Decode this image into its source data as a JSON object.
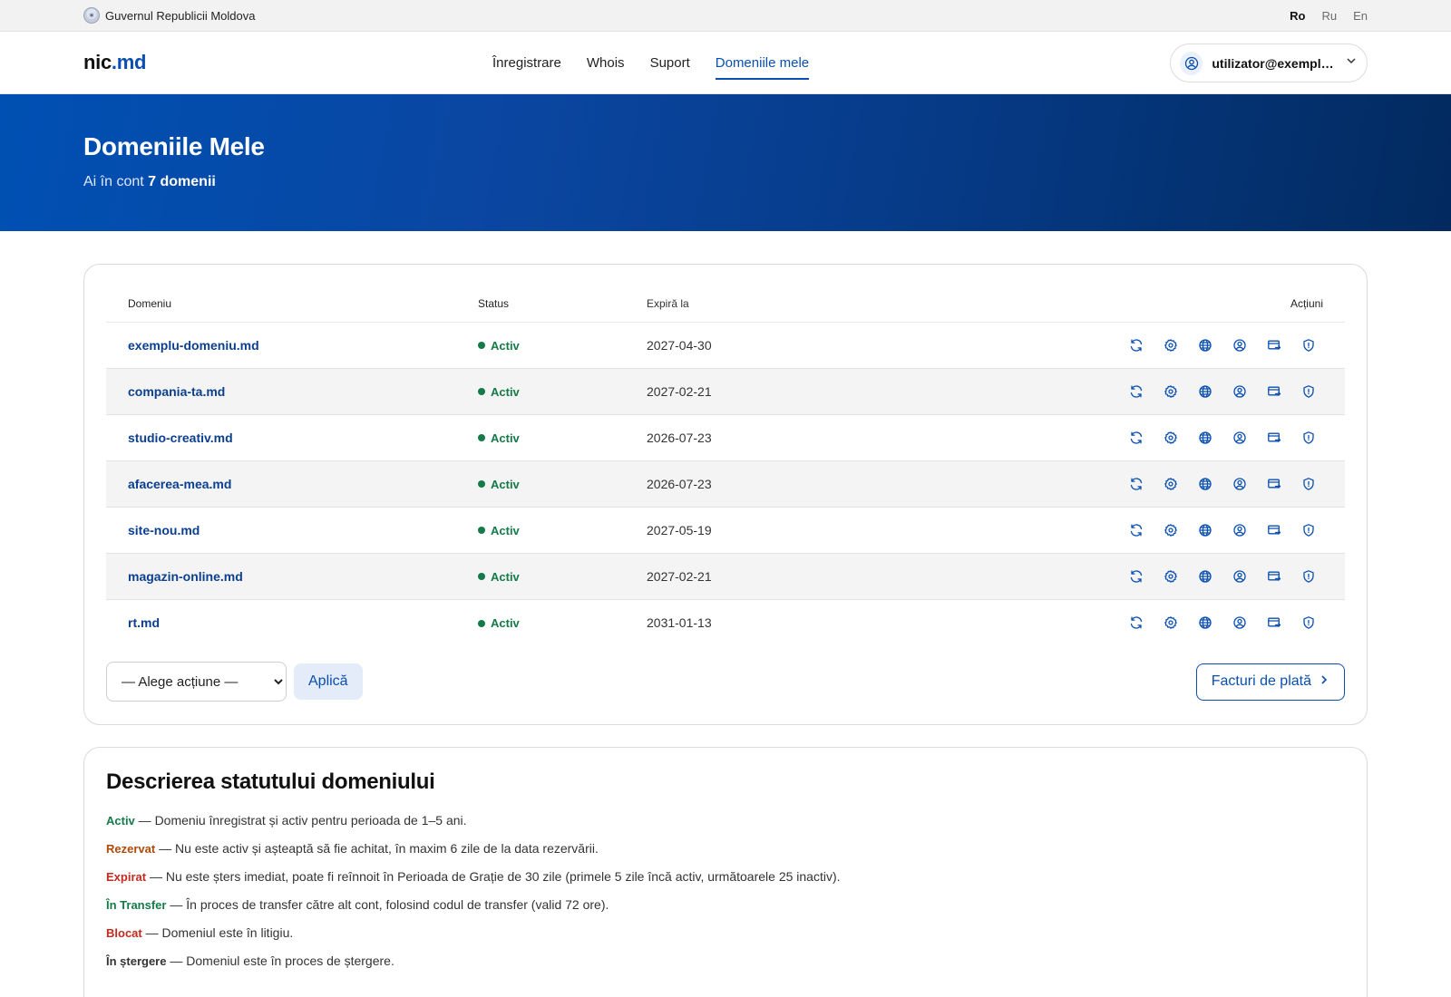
{
  "govbar": {
    "title": "Guvernul Republicii Moldova",
    "languages": [
      "Ro",
      "Ru",
      "En"
    ],
    "active_language": "Ro"
  },
  "header": {
    "logo_main": "nic",
    "logo_suffix": ".md",
    "nav": [
      {
        "label": "Înregistrare"
      },
      {
        "label": "Whois"
      },
      {
        "label": "Suport"
      },
      {
        "label": "Domeniile mele"
      }
    ],
    "active_nav": "Domeniile mele",
    "user_email": "utilizator@exemplu..."
  },
  "hero": {
    "title": "Domeniile Mele",
    "subtitle_prefix": "Ai în cont",
    "subtitle_count": "7 domenii"
  },
  "table": {
    "columns": {
      "domain": "Domeniu",
      "status": "Status",
      "expires": "Expiră la",
      "actions": "Acțiuni"
    },
    "rows": [
      {
        "domain": "exemplu-domeniu.md",
        "status": "Activ",
        "expires": "2027-04-30"
      },
      {
        "domain": "compania-ta.md",
        "status": "Activ",
        "expires": "2027-02-21"
      },
      {
        "domain": "studio-creativ.md",
        "status": "Activ",
        "expires": "2026-07-23"
      },
      {
        "domain": "afacerea-mea.md",
        "status": "Activ",
        "expires": "2026-07-23"
      },
      {
        "domain": "site-nou.md",
        "status": "Activ",
        "expires": "2027-05-19"
      },
      {
        "domain": "magazin-online.md",
        "status": "Activ",
        "expires": "2027-02-21"
      },
      {
        "domain": "rt.md",
        "status": "Activ",
        "expires": "2031-01-13"
      }
    ],
    "row_action_icons": [
      "renew-icon",
      "settings-icon",
      "dns-globe-icon",
      "contact-icon",
      "transfer-icon",
      "security-shield-icon"
    ]
  },
  "footer_actions": {
    "bulk_select_value": "— Alege acțiune —",
    "apply_label": "Aplică",
    "invoices_label": "Facturi de plată"
  },
  "status_description": {
    "title": "Descrierea statutului domeniului",
    "items": [
      {
        "key": "Activ",
        "text": " — Domeniu înregistrat și activ pentru perioada de 1–5 ani.",
        "color": "#147a48"
      },
      {
        "key": "Rezervat",
        "text": " — Nu este activ și așteaptă să fie achitat, în maxim 6 zile de la data rezervării.",
        "color": "#b04a0a"
      },
      {
        "key": "Expirat",
        "text": " — Nu este șters imediat, poate fi reînnoit în Perioada de Grație de 30 zile (primele 5 zile încă activ, următoarele 25 inactiv).",
        "color": "#c22a1f"
      },
      {
        "key": "În Transfer",
        "text": " — În proces de transfer către alt cont, folosind codul de transfer (valid 72 ore).",
        "color": "#147a48"
      },
      {
        "key": "Blocat",
        "text": " — Domeniul este în litigiu.",
        "color": "#c22a1f"
      },
      {
        "key": "În ștergere",
        "text": " — Domeniul este în proces de ștergere.",
        "color": "#333333"
      }
    ]
  },
  "colors": {
    "brand_blue": "#0a4fb0",
    "active_green": "#147a48"
  }
}
